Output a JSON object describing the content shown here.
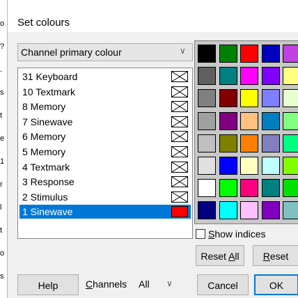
{
  "left_strip": [
    "o",
    "?",
    ".",
    "s",
    "t",
    "e",
    "1",
    "r",
    "l",
    "t",
    "o",
    "s"
  ],
  "title": "Set colours",
  "channel_select": {
    "value": "Channel primary colour"
  },
  "channels": [
    {
      "label": "31 Keyboard"
    },
    {
      "label": "10 Textmark"
    },
    {
      "label": "8 Memory"
    },
    {
      "label": "7 Sinewave"
    },
    {
      "label": "6 Memory"
    },
    {
      "label": "5 Memory"
    },
    {
      "label": "4 Textmark"
    },
    {
      "label": "3 Response"
    },
    {
      "label": "2 Stimulus"
    },
    {
      "label": "1 Sinewave",
      "selected": true,
      "color": "#ff0000"
    }
  ],
  "palette": [
    [
      "#000000",
      "#008000",
      "#ff0000",
      "#0000c0",
      "#c040e0"
    ],
    [
      "#606060",
      "#008080",
      "#ff00ff",
      "#8000ff",
      "#ffff80"
    ],
    [
      "#808080",
      "#800000",
      "#ffff00",
      "#8080ff",
      "#e8ffd0"
    ],
    [
      "#a0a0a0",
      "#800080",
      "#ffc080",
      "#0080c0",
      "#80ff80"
    ],
    [
      "#c0c0c0",
      "#808000",
      "#ff8000",
      "#8080c0",
      "#00ff80"
    ],
    [
      "#e0e0e0",
      "#0000ff",
      "#ffffc0",
      "#c0ffff",
      "#80ff00"
    ],
    [
      "#ffffff",
      "#00ff00",
      "#ff0080",
      "#008080",
      "#00e000"
    ],
    [
      "#000080",
      "#00ffff",
      "#ffc0ff",
      "#8000c0",
      "#80c0c0"
    ]
  ],
  "show_indices": {
    "label": "Show indices",
    "checked": false
  },
  "buttons": {
    "reset_all": "Reset All",
    "reset": "Reset",
    "help": "Help",
    "cancel": "Cancel",
    "ok": "OK"
  },
  "channels_filter": {
    "label": "Channels",
    "value": "All"
  },
  "icons": {
    "dropdown": "chevron-down-icon"
  }
}
